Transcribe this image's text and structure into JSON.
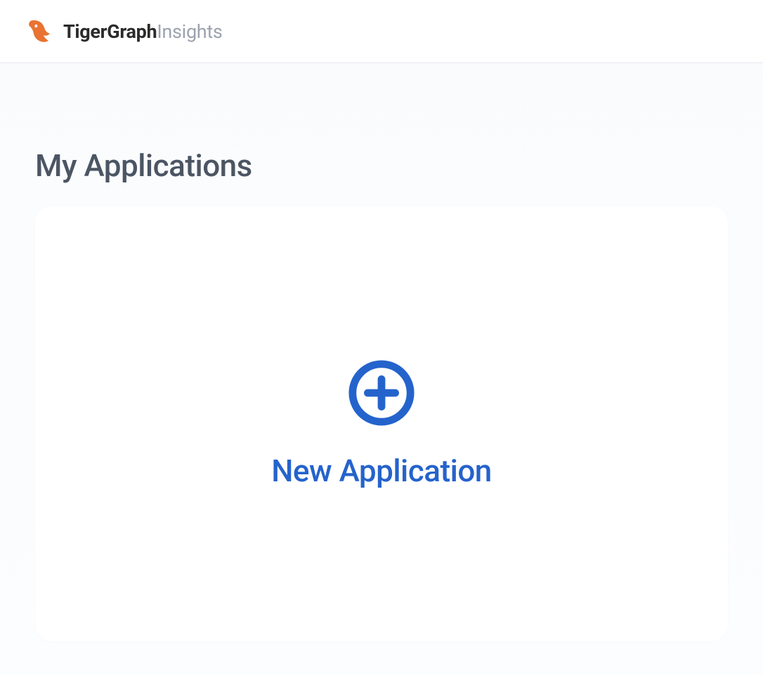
{
  "header": {
    "brand_primary": "TigerGraph",
    "brand_secondary": "Insights"
  },
  "main": {
    "title": "My Applications",
    "new_app_label": "New Application"
  },
  "colors": {
    "accent_blue": "#2563cc",
    "logo_orange": "#e97332"
  }
}
